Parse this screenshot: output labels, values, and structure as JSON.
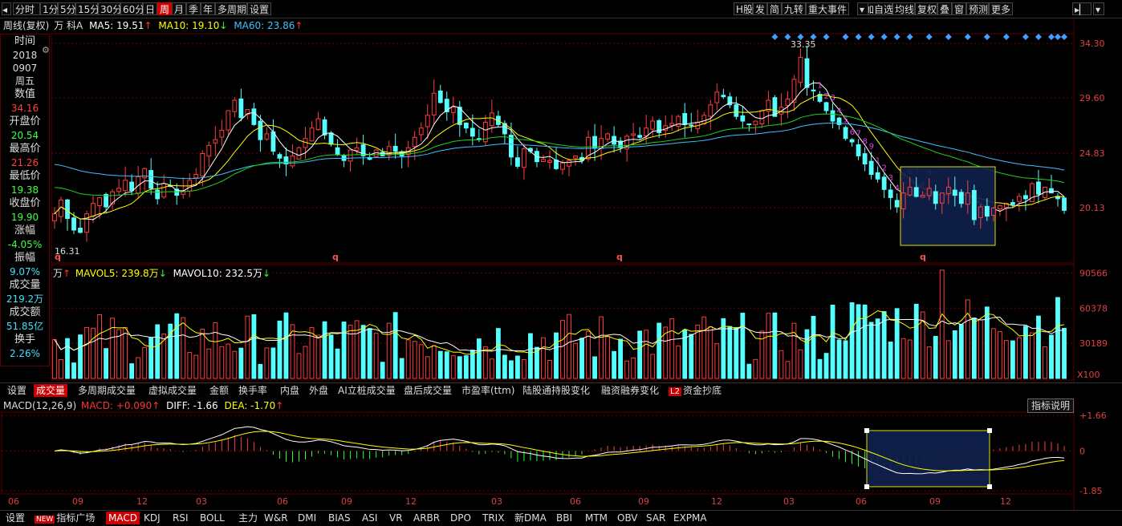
{
  "toolbar": {
    "left_items": [
      "分时",
      "1分",
      "5分",
      "15分",
      "30分",
      "60分",
      "日",
      "周",
      "月",
      "季",
      "年",
      "多周期",
      "设置"
    ],
    "active": "周",
    "right_items": [
      "H股",
      "发",
      "简",
      "九转",
      "重大事件",
      "加自选",
      "均线",
      "复权",
      "叠",
      "窗",
      "预测",
      "更多"
    ]
  },
  "info": {
    "period": "周线(复权)",
    "name": "万 科A",
    "ma5": "MA5: 19.51",
    "ma10": "MA10: 19.10",
    "ma60": "MA60: 23.86",
    "colors": {
      "ma5": "#ffffff",
      "ma10": "#ffff00",
      "ma60": "#40c0ff"
    }
  },
  "side_panel": {
    "rows": [
      {
        "label": "时间",
        "value": "2018",
        "vcolor": "#dddddd"
      },
      {
        "label": "",
        "value": "0907",
        "vcolor": "#dddddd"
      },
      {
        "label": "",
        "value": "周五",
        "vcolor": "#dddddd"
      },
      {
        "label": "数值",
        "value": "34.16",
        "vcolor": "#ff4040"
      },
      {
        "label": "开盘价",
        "value": "20.54",
        "vcolor": "#40ff40"
      },
      {
        "label": "最高价",
        "value": "21.26",
        "vcolor": "#ff4040"
      },
      {
        "label": "最低价",
        "value": "19.38",
        "vcolor": "#40ff40"
      },
      {
        "label": "收盘价",
        "value": "19.90",
        "vcolor": "#40ff40"
      },
      {
        "label": "涨幅",
        "value": "-4.05%",
        "vcolor": "#40ff40"
      },
      {
        "label": "振幅",
        "value": "9.07%",
        "vcolor": "#40e0ff"
      },
      {
        "label": "成交量",
        "value": "219.2万",
        "vcolor": "#40e0ff"
      },
      {
        "label": "成交额",
        "value": "51.85亿",
        "vcolor": "#40e0ff"
      },
      {
        "label": "换手",
        "value": "2.26%",
        "vcolor": "#40e0ff"
      }
    ]
  },
  "price_axis": [
    "34.30",
    "29.60",
    "24.83",
    "20.13"
  ],
  "price_annotations": {
    "high": "33.35",
    "low": "16.31",
    "q_marks": [
      "q",
      "q",
      "q",
      "q"
    ]
  },
  "volume_info": {
    "unit_prefix": "万",
    "mavol5": "MAVOL5: 239.8万",
    "mavol10": "MAVOL10: 232.5万",
    "axis": [
      "90566",
      "60378",
      "30189"
    ],
    "unit": "X100"
  },
  "mid_tabs": [
    "设置",
    "成交量",
    "多周期成交量",
    "虚拟成交量",
    "金额",
    "换手率",
    "内盘",
    "外盘",
    "AI立桩成交量",
    "盘后成交量",
    "市盈率(ttm)",
    "陆股通持股变化",
    "融资融券变化",
    "资金抄底"
  ],
  "mid_tab_active": "成交量",
  "l2_badge": "L2",
  "macd_info": {
    "title": "MACD(12,26,9)",
    "macd": "MACD: +0.090",
    "diff": "DIFF: -1.66",
    "dea": "DEA: -1.70",
    "explain_button": "指标说明",
    "axis": [
      "+1.66",
      "0",
      "-1.85"
    ]
  },
  "x_axis": [
    "06",
    "09",
    "12",
    "03",
    "06",
    "09",
    "12",
    "03",
    "06",
    "09",
    "12",
    "03",
    "06",
    "09",
    "12"
  ],
  "bottom_tabs": [
    "设置",
    "指标广场",
    "MACD",
    "KDJ",
    "RSI",
    "BOLL",
    "主力",
    "W&R",
    "DMI",
    "BIAS",
    "ASI",
    "VR",
    "ARBR",
    "DPO",
    "TRIX",
    "新DMA",
    "BBI",
    "MTM",
    "OBV",
    "SAR",
    "EXPMA"
  ],
  "bottom_tab_active": "MACD",
  "new_badge": "NEW",
  "nine_turn_labels": [
    "1",
    "2",
    "3",
    "4",
    "5",
    "6",
    "7",
    "8",
    "9",
    "1",
    "2",
    "3",
    "4",
    "5",
    "6",
    "7",
    "8",
    "9"
  ],
  "chart_data": {
    "type": "candlestick",
    "price_range": [
      15.5,
      35.0
    ],
    "closes": [
      19.6,
      20.8,
      19.2,
      18.2,
      18.0,
      19.6,
      20.5,
      21.0,
      20.2,
      21.5,
      21.8,
      22.5,
      21.6,
      22.8,
      23.5,
      21.8,
      20.9,
      22.2,
      22.0,
      21.2,
      21.6,
      22.5,
      23.0,
      24.8,
      25.5,
      26.0,
      26.8,
      28.5,
      29.4,
      27.9,
      28.6,
      27.3,
      26.0,
      26.5,
      25.0,
      24.4,
      23.9,
      24.6,
      25.3,
      26.1,
      27.0,
      27.8,
      26.4,
      25.6,
      24.7,
      24.2,
      25.1,
      25.3,
      24.6,
      24.3,
      25.1,
      24.6,
      25.4,
      25.0,
      24.6,
      25.3,
      26.2,
      27.0,
      28.1,
      30.0,
      29.2,
      28.4,
      28.8,
      27.3,
      27.0,
      26.3,
      26.0,
      27.5,
      28.3,
      27.3,
      26.5,
      24.5,
      23.7,
      25.2,
      25.0,
      24.1,
      24.3,
      24.2,
      23.5,
      24.0,
      24.2,
      24.6,
      24.2,
      26.2,
      25.3,
      26.1,
      26.5,
      25.6,
      25.3,
      26.3,
      26.5,
      26.2,
      27.0,
      27.6,
      26.6,
      27.2,
      27.4,
      28.0,
      27.3,
      27.2,
      27.5,
      28.1,
      29.0,
      30.1,
      29.7,
      29.0,
      28.0,
      27.6,
      27.3,
      27.6,
      28.5,
      29.4,
      28.0,
      28.8,
      29.5,
      31.2,
      33.1,
      30.5,
      30.2,
      29.3,
      28.5,
      27.6,
      27.3,
      26.1,
      25.8,
      24.6,
      23.9,
      23.0,
      22.6,
      21.7,
      21.0,
      20.2,
      21.4,
      21.9,
      21.1,
      21.2,
      21.8,
      20.5,
      21.4,
      21.9,
      21.2,
      20.5,
      21.4,
      19.1,
      20.2,
      19.4,
      20.1,
      20.3,
      20.5,
      20.4,
      21.1,
      20.9,
      22.2,
      21.3,
      21.9,
      21.4,
      20.9,
      19.9
    ],
    "ma60_start": 24.0,
    "highlight_boxes": [
      "price-box",
      "macd-box"
    ]
  }
}
